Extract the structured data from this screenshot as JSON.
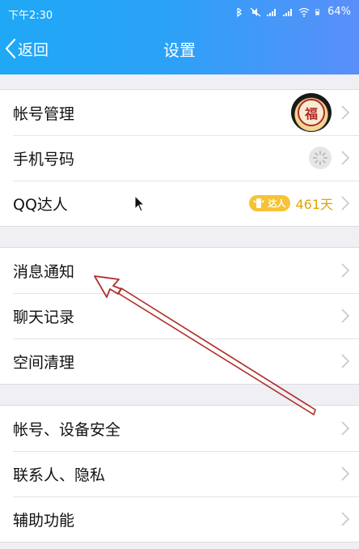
{
  "status_bar": {
    "time": "下午2:30",
    "battery": "64%"
  },
  "header": {
    "back_label": "返回",
    "title": "设置"
  },
  "groups": [
    {
      "items": [
        {
          "label": "帐号管理",
          "accessory": "avatar",
          "avatar_text": "福"
        },
        {
          "label": "手机号码",
          "accessory": "spinner"
        },
        {
          "label": "QQ达人",
          "accessory": "badge",
          "badge_text": "达人",
          "days": "461天"
        }
      ]
    },
    {
      "items": [
        {
          "label": "消息通知"
        },
        {
          "label": "聊天记录"
        },
        {
          "label": "空间清理"
        }
      ]
    },
    {
      "items": [
        {
          "label": "帐号、设备安全"
        },
        {
          "label": "联系人、隐私"
        },
        {
          "label": "辅助功能"
        }
      ]
    }
  ],
  "colors": {
    "header_start": "#1fa8f5",
    "header_end": "#5a8ff9",
    "background": "#efeff4",
    "badge": "#f6c336",
    "days_text": "#e2a400",
    "annotation_arrow": "#b0302a"
  },
  "icons": {
    "back": "chevron-left-icon",
    "row_chevron": "chevron-right-icon"
  }
}
